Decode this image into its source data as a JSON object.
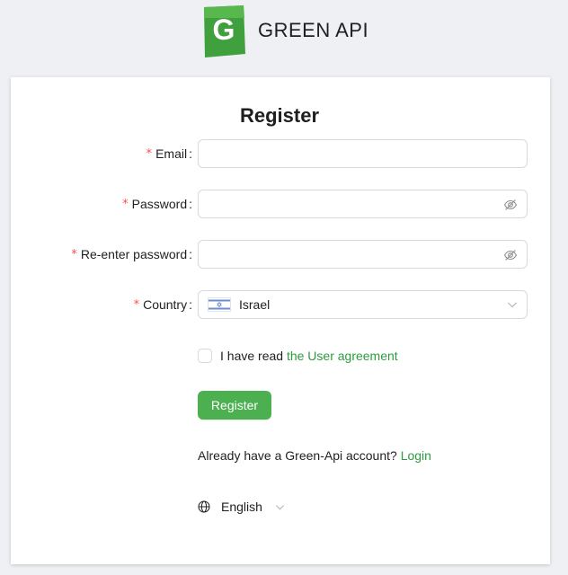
{
  "brand": {
    "name": "GREEN API",
    "logo_letter": "G",
    "logo_color": "#3fa03d"
  },
  "form": {
    "title": "Register",
    "fields": {
      "email": {
        "label": "Email",
        "value": ""
      },
      "password": {
        "label": "Password",
        "value": ""
      },
      "reenter_password": {
        "label": "Re-enter password",
        "value": ""
      },
      "country": {
        "label": "Country",
        "value": "Israel",
        "flag_icon": "israel-flag-icon"
      }
    },
    "agreement": {
      "text": "I have read",
      "link": "the User agreement",
      "checked": false
    },
    "submit_label": "Register",
    "already": {
      "text": "Already have a Green-Api account?",
      "link": "Login"
    },
    "language": {
      "value": "English"
    }
  },
  "colors": {
    "accent": "#4caf50",
    "link": "#2e9b3e",
    "required": "#ff4d4f"
  }
}
